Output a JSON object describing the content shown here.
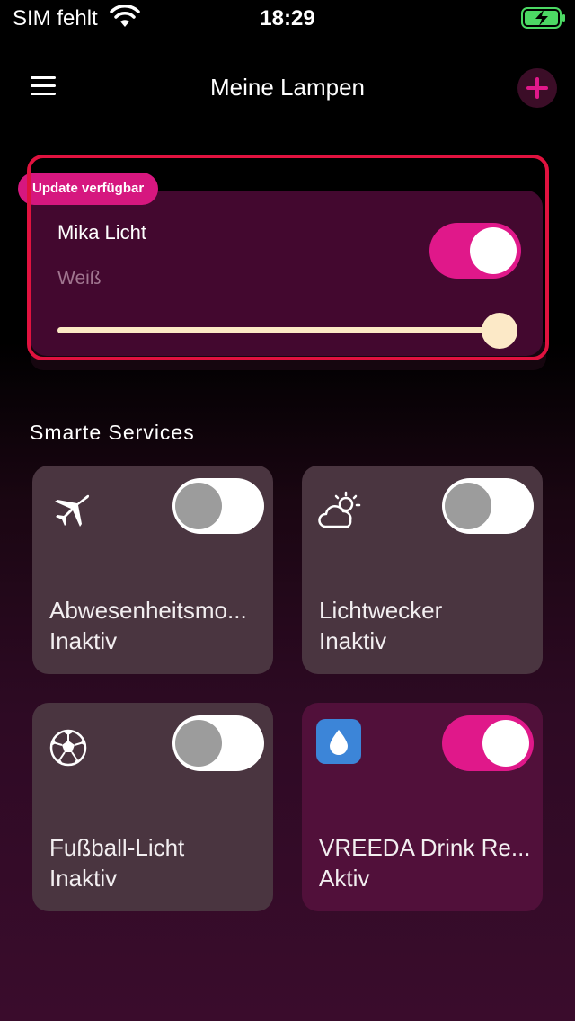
{
  "status_bar": {
    "carrier": "SIM fehlt",
    "time": "18:29"
  },
  "nav": {
    "title": "Meine Lampen"
  },
  "lamp": {
    "badge": "Update verfügbar",
    "name": "Mika Licht",
    "mode": "Weiß",
    "toggle_on": true,
    "brightness_percent": 100
  },
  "services": {
    "title": "Smarte Services",
    "items": [
      {
        "name": "Abwesenheitsmo...",
        "status": "Inaktiv",
        "icon": "airplane-icon",
        "on": false
      },
      {
        "name": "Lichtwecker",
        "status": "Inaktiv",
        "icon": "sun-cloud-icon",
        "on": false
      },
      {
        "name": "Fußball-Licht",
        "status": "Inaktiv",
        "icon": "soccer-ball-icon",
        "on": false
      },
      {
        "name": "VREEDA Drink Re...",
        "status": "Aktiv",
        "icon": "water-drop-icon",
        "on": true
      }
    ]
  },
  "colors": {
    "accent": "#e0188a",
    "highlight": "#e0123f",
    "card_inactive": "#4a3540",
    "card_active": "#51103a",
    "drop_icon_bg": "#3c85d8"
  }
}
